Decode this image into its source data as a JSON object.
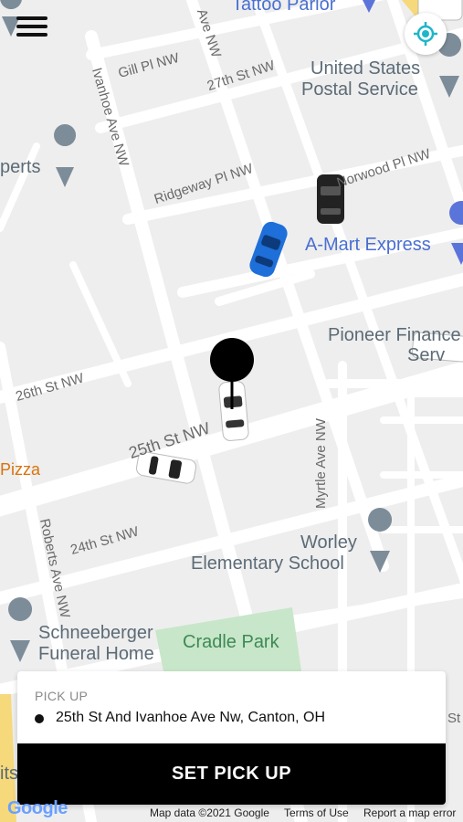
{
  "map": {
    "streets": {
      "ivanhoe": "Ivanhoe Ave NW",
      "gill": "Gill Pl NW",
      "st27": "27th St NW",
      "ridgeway": "Ridgeway Pl NW",
      "norwood": "Norwood Pl NW",
      "st26": "26th St NW",
      "st25": "25th St NW",
      "st24": "24th St NW",
      "roberts": "Roberts Ave NW",
      "myrtle": "Myrtle Ave NW",
      "ave_top": "Ave NW"
    },
    "places": {
      "tattoo": "Tattoo Parlor",
      "usps_line1": "United States",
      "usps_line2": "Postal Service",
      "amart": "A-Mart Express",
      "pioneer_line1": "Pioneer Finance",
      "pioneer_line2": "Serv",
      "experts": "perts",
      "pizza": "Pizza",
      "worley_line1": "Worley",
      "worley_line2": "Elementary School",
      "cradle": "Cradle Park",
      "schneeberger_line1": "Schneeberger",
      "schneeberger_line2": "Funeral Home",
      "its": "its",
      "st_right": "St"
    },
    "colors": {
      "road": "#ffffff",
      "land": "#eeeeee",
      "park": "#c8e6c9",
      "car_blue": "#1e6fd9",
      "car_black": "#222222",
      "car_white": "#ffffff"
    }
  },
  "controls": {
    "menu_icon": "hamburger-menu-icon",
    "locate_icon": "crosshair-locate-icon"
  },
  "pickup_card": {
    "label": "PICK UP",
    "address": "25th St And Ivanhoe Ave Nw, Canton, OH",
    "button_label": "SET PICK UP"
  },
  "footer": {
    "google": "Google",
    "map_data": "Map data ©2021 Google",
    "terms": "Terms of Use",
    "report": "Report a map error"
  }
}
